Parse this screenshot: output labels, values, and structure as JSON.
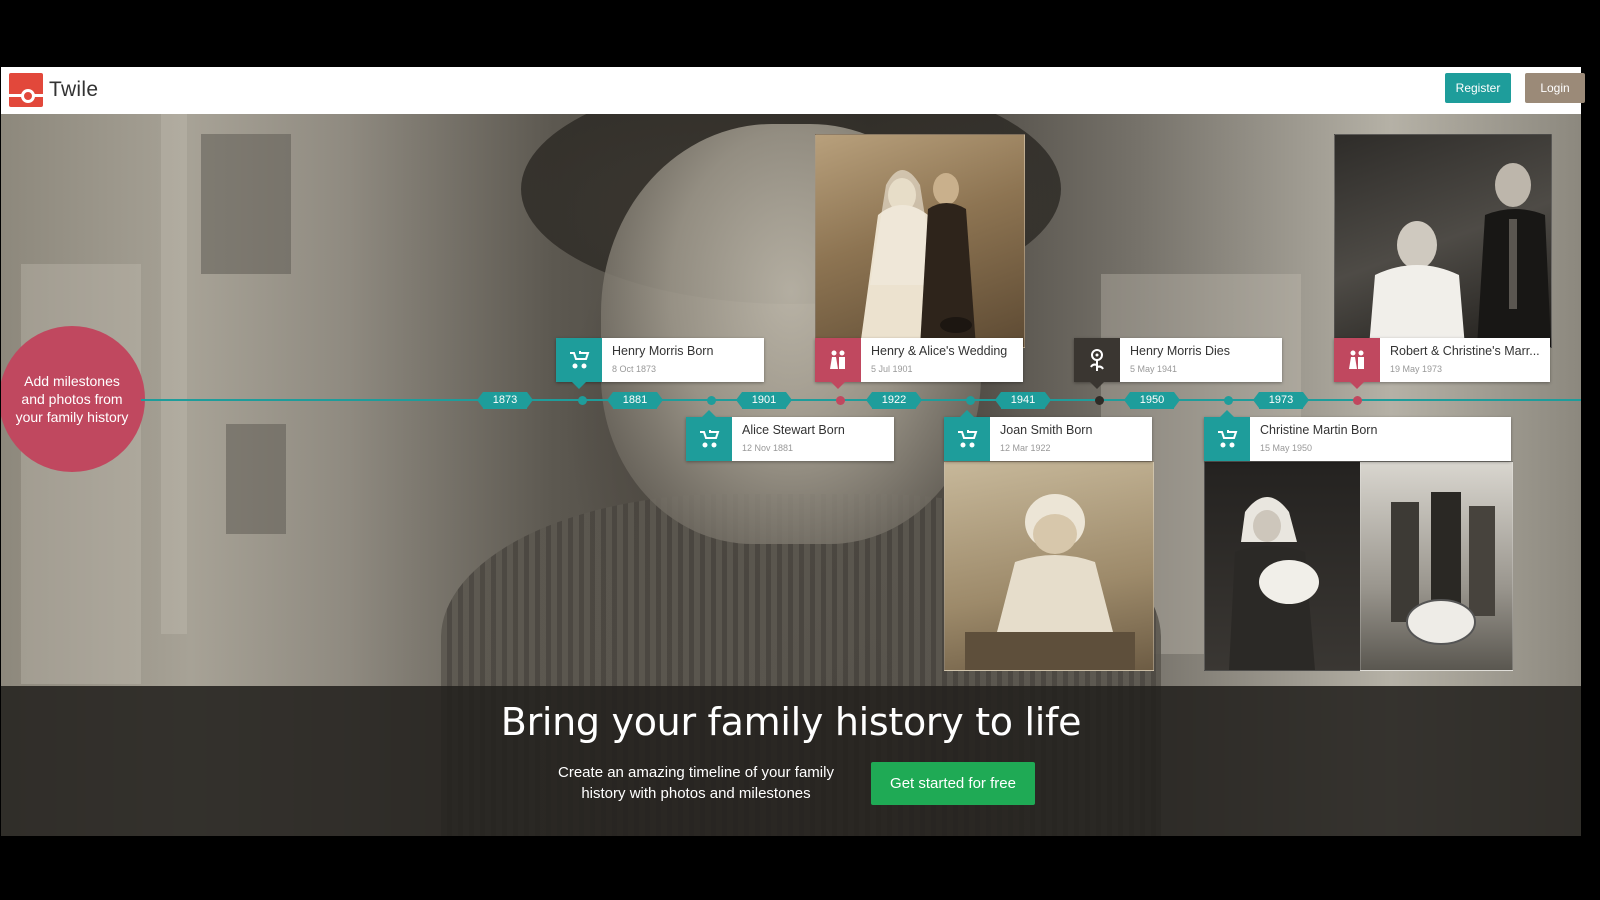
{
  "brand": {
    "name": "Twile"
  },
  "nav": {
    "register_label": "Register",
    "login_label": "Login"
  },
  "colors": {
    "teal": "#1e9d9b",
    "pink": "#c0485f",
    "dark": "#3a3631",
    "cta_green": "#1faa55",
    "logo_red": "#e2483b"
  },
  "intro": {
    "text": "Add milestones and photos from your family history"
  },
  "timeline": {
    "years": [
      "1873",
      "1881",
      "1901",
      "1922",
      "1941",
      "1950",
      "1973"
    ],
    "events": [
      {
        "title": "Henry Morris Born",
        "date": "8 Oct 1873",
        "icon": "pram-icon",
        "color": "teal"
      },
      {
        "title": "Alice Stewart Born",
        "date": "12 Nov 1881",
        "icon": "pram-icon",
        "color": "teal"
      },
      {
        "title": "Henry & Alice's Wedding",
        "date": "5 Jul 1901",
        "icon": "couple-icon",
        "color": "pink"
      },
      {
        "title": "Joan Smith Born",
        "date": "12 Mar 1922",
        "icon": "pram-icon",
        "color": "teal"
      },
      {
        "title": "Henry Morris Dies",
        "date": "5 May 1941",
        "icon": "flower-icon",
        "color": "dark"
      },
      {
        "title": "Christine Martin Born",
        "date": "15 May 1950",
        "icon": "pram-icon",
        "color": "teal"
      },
      {
        "title": "Robert & Christine's Marr...",
        "date": "19 May 1973",
        "icon": "couple-icon",
        "color": "pink"
      }
    ]
  },
  "hero": {
    "headline": "Bring your family history to life",
    "subtext": "Create an amazing timeline of your family history with photos and milestones",
    "cta_label": "Get started for free"
  }
}
